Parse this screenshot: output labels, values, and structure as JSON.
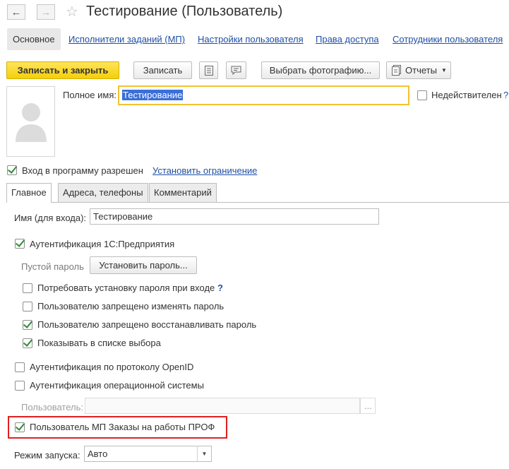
{
  "window": {
    "title": "Тестирование (Пользователь)",
    "back_icon": "arrow-left-icon",
    "forward_icon": "arrow-right-icon",
    "favorite_icon": "star-icon"
  },
  "nav_tabs": [
    {
      "label": "Основное",
      "active": true
    },
    {
      "label": "Исполнители заданий (МП)"
    },
    {
      "label": "Настройки пользователя"
    },
    {
      "label": "Права доступа"
    },
    {
      "label": "Сотрудники пользователя"
    }
  ],
  "toolbar": {
    "save_close_label": "Записать и закрыть",
    "save_label": "Записать",
    "choose_photo_label": "Выбрать фотографию...",
    "reports_label": "Отчеты"
  },
  "header_fields": {
    "full_name_label": "Полное имя:",
    "full_name_value": "Тестирование",
    "invalid_label": "Недействителен",
    "help_mark": "?"
  },
  "login": {
    "allowed_label": "Вход в программу разрешен",
    "set_limit_link": "Установить ограничение"
  },
  "content_tabs": [
    {
      "label": "Главное",
      "active": true
    },
    {
      "label": "Адреса, телефоны"
    },
    {
      "label": "Комментарий"
    }
  ],
  "main": {
    "login_name_label": "Имя (для входа):",
    "login_name_value": "Тестирование",
    "auth_1c_label": "Аутентификация 1С:Предприятия",
    "empty_password_label": "Пустой пароль",
    "set_password_label": "Установить пароль...",
    "require_password_label": "Потребовать установку пароля при входе",
    "require_password_help": "?",
    "deny_change_label": "Пользователю запрещено изменять пароль",
    "deny_restore_label": "Пользователю запрещено восстанавливать пароль",
    "show_in_list_label": "Показывать в списке выбора",
    "openid_label": "Аутентификация по протоколу OpenID",
    "os_auth_label": "Аутентификация операционной системы",
    "os_user_label": "Пользователь:",
    "os_user_button": "...",
    "mp_user_label": "Пользователь МП Заказы на работы ПРОФ",
    "startup_mode_label": "Режим запуска:",
    "startup_mode_value": "Авто"
  },
  "colors": {
    "accent_yellow": "#f4cf0a",
    "link_blue": "#1f4fa3",
    "check_green": "#2e8b3a",
    "highlight_red": "#e02020",
    "focus_border": "#f2c230"
  }
}
